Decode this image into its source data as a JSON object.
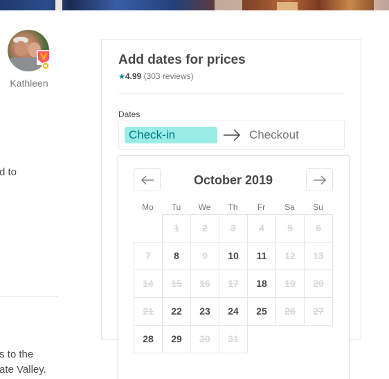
{
  "host": {
    "name": "Kathleen"
  },
  "left_fragments": {
    "line1": "d to",
    "line2": "s to the",
    "line3": "ate Valley."
  },
  "booking": {
    "title": "Add dates for prices",
    "rating_value": "4.99",
    "rating_count": "(303 reviews)",
    "dates_label": "Dates",
    "checkin_label": "Check-in",
    "checkout_label": "Checkout"
  },
  "calendar": {
    "month": "October 2019",
    "weekdays": [
      "Mo",
      "Tu",
      "We",
      "Th",
      "Fr",
      "Sa",
      "Su"
    ],
    "weeks": [
      [
        null,
        {
          "d": "1",
          "blocked": true
        },
        {
          "d": "2",
          "blocked": true
        },
        {
          "d": "3",
          "blocked": true
        },
        {
          "d": "4",
          "blocked": true
        },
        {
          "d": "5",
          "blocked": true
        },
        {
          "d": "6",
          "blocked": true
        }
      ],
      [
        {
          "d": "7",
          "blocked": true
        },
        {
          "d": "8",
          "blocked": false
        },
        {
          "d": "9",
          "blocked": true
        },
        {
          "d": "10",
          "blocked": false
        },
        {
          "d": "11",
          "blocked": false
        },
        {
          "d": "12",
          "blocked": true
        },
        {
          "d": "13",
          "blocked": true
        }
      ],
      [
        {
          "d": "14",
          "blocked": true
        },
        {
          "d": "15",
          "blocked": true
        },
        {
          "d": "16",
          "blocked": true
        },
        {
          "d": "17",
          "blocked": true
        },
        {
          "d": "18",
          "blocked": false
        },
        {
          "d": "19",
          "blocked": true
        },
        {
          "d": "20",
          "blocked": true
        }
      ],
      [
        {
          "d": "21",
          "blocked": true
        },
        {
          "d": "22",
          "blocked": false
        },
        {
          "d": "23",
          "blocked": false
        },
        {
          "d": "24",
          "blocked": false
        },
        {
          "d": "25",
          "blocked": false
        },
        {
          "d": "26",
          "blocked": true
        },
        {
          "d": "27",
          "blocked": true
        }
      ],
      [
        {
          "d": "28",
          "blocked": false
        },
        {
          "d": "29",
          "blocked": false
        },
        {
          "d": "30",
          "blocked": true
        },
        {
          "d": "31",
          "blocked": true
        },
        null,
        null,
        null
      ]
    ]
  },
  "colors": {
    "accent": "#008489",
    "checkin_highlight": "#99ede6",
    "text": "#484848",
    "muted": "#767676"
  },
  "icons": [
    "superhost-badge-icon",
    "arrow-right-icon",
    "arrow-left-icon",
    "star-icon"
  ]
}
